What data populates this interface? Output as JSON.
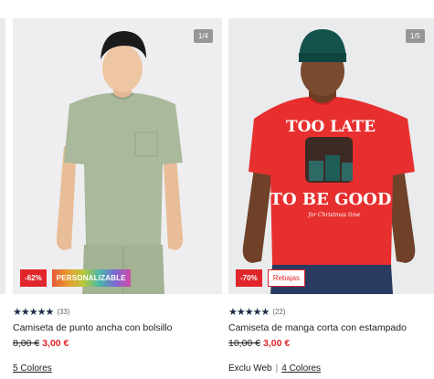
{
  "products": [
    {
      "counter": "1/4",
      "badges": {
        "discount": "-62%",
        "tag": "PERSONALIZABLE"
      },
      "stars": "★★★★★",
      "reviews": "(33)",
      "title": "Camiseta de punto ancha con bolsillo",
      "old_price": "8,00 €",
      "new_price": "3,00 €",
      "colors_link": "5 Colores"
    },
    {
      "counter": "1/5",
      "badges": {
        "discount": "-70%",
        "tag": "Rebajas"
      },
      "stars": "★★★★★",
      "reviews": "(22)",
      "title": "Camiseta de manga corta con estampado",
      "old_price": "10,00 €",
      "new_price": "3,00 €",
      "exclusive": "Exclu Web",
      "separator": "|",
      "colors_link": "4 Colores",
      "shirt_print": [
        "TOO LATE",
        "TO BE GOOD",
        "for Christmas time"
      ]
    }
  ],
  "colors": {
    "accent": "#e1262b",
    "star": "#1c2b4a"
  }
}
